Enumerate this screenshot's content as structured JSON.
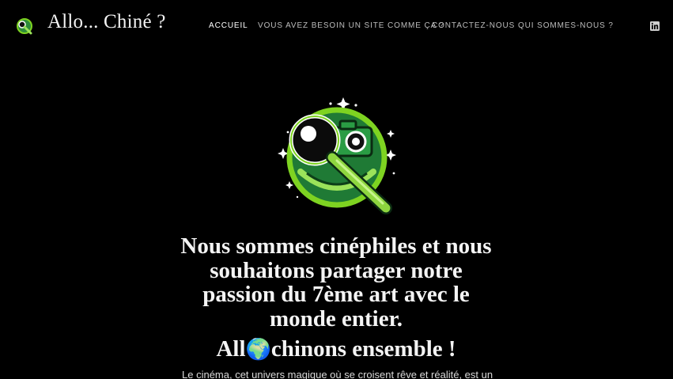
{
  "brand": {
    "name": "Allo... Chiné ?",
    "logo_icon": "magnifier-film-camera-logo"
  },
  "nav": {
    "items": [
      {
        "label": "ACCUEIL",
        "active": true
      },
      {
        "label": "VOUS AVEZ BESOIN UN SITE COMME ÇA ?",
        "active": false
      },
      {
        "label": "CONTACTEZ-NOUS",
        "active": false
      },
      {
        "label": "QUI SOMMES-NOUS ?",
        "active": false
      }
    ],
    "social_icon": "linkedin-icon"
  },
  "hero": {
    "headline_before": "Nous sommes ",
    "headline_highlight": "cinéphiles",
    "headline_after": " et nous souhaitons partager notre passion du 7ème art avec le monde entier.",
    "headline2_highlight_start": "All",
    "headline2_globe": "🌍",
    "headline2_highlight_end": "chinons",
    "headline2_rest": " ensemble !",
    "intro": "Le cinéma, cet univers magique où se croisent rêve et réalité, est un"
  },
  "colors": {
    "background": "#000000",
    "highlight": "#1e9a4c",
    "logo_green": "#7ed321"
  }
}
